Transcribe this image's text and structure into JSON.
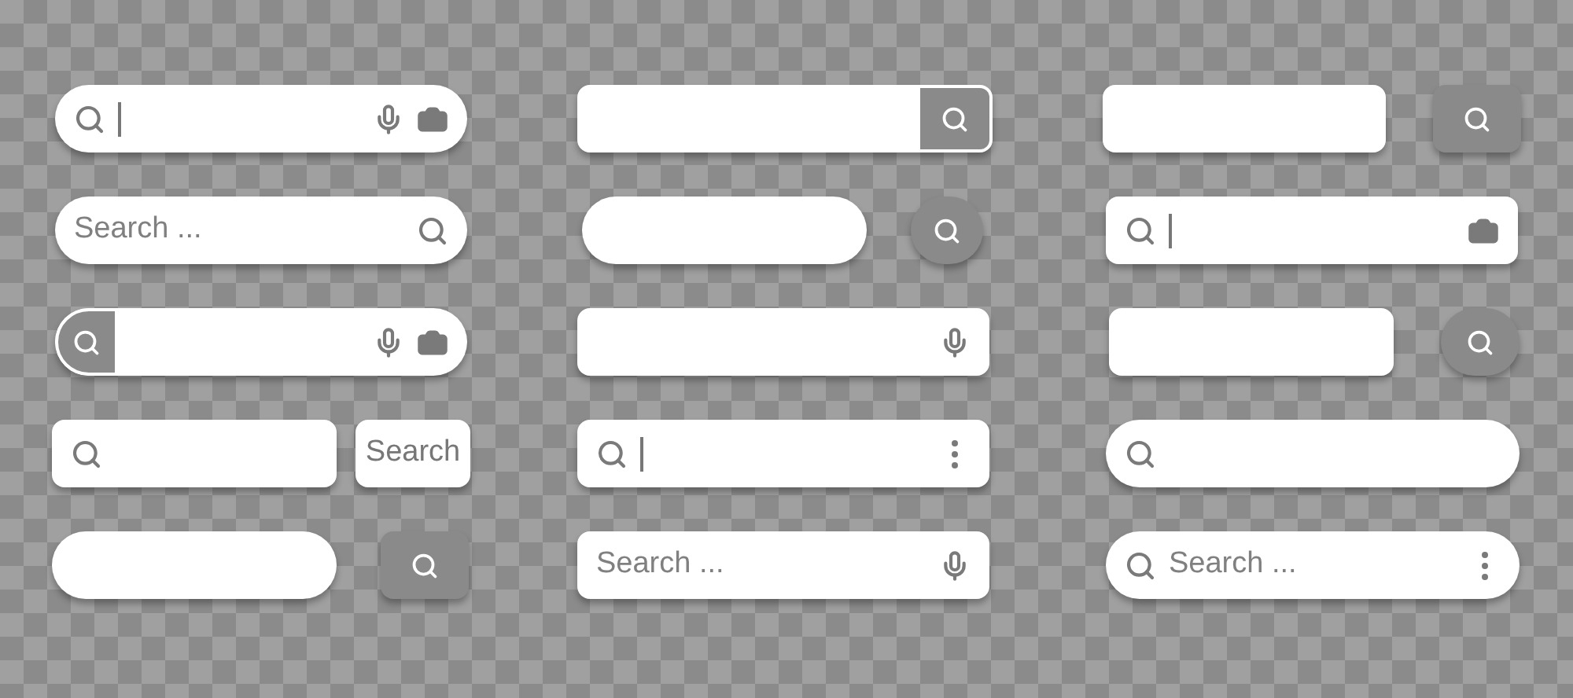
{
  "columns": [
    {
      "bars": [
        {
          "kind": "voice-camera"
        },
        {
          "kind": "placeholder-right",
          "placeholder": "Search ..."
        },
        {
          "kind": "segment-voice-camera"
        },
        {
          "kind": "text-button",
          "button_label": "Search"
        },
        {
          "kind": "pill-square-button"
        }
      ]
    },
    {
      "bars": [
        {
          "kind": "attached-button"
        },
        {
          "kind": "pill-circle-button"
        },
        {
          "kind": "voice"
        },
        {
          "kind": "menu"
        },
        {
          "kind": "placeholder-voice",
          "placeholder": "Search ..."
        }
      ]
    },
    {
      "bars": [
        {
          "kind": "square-button"
        },
        {
          "kind": "camera"
        },
        {
          "kind": "circle-button"
        },
        {
          "kind": "pill-search"
        },
        {
          "kind": "pill-placeholder-menu",
          "placeholder": "Search ..."
        }
      ]
    }
  ]
}
